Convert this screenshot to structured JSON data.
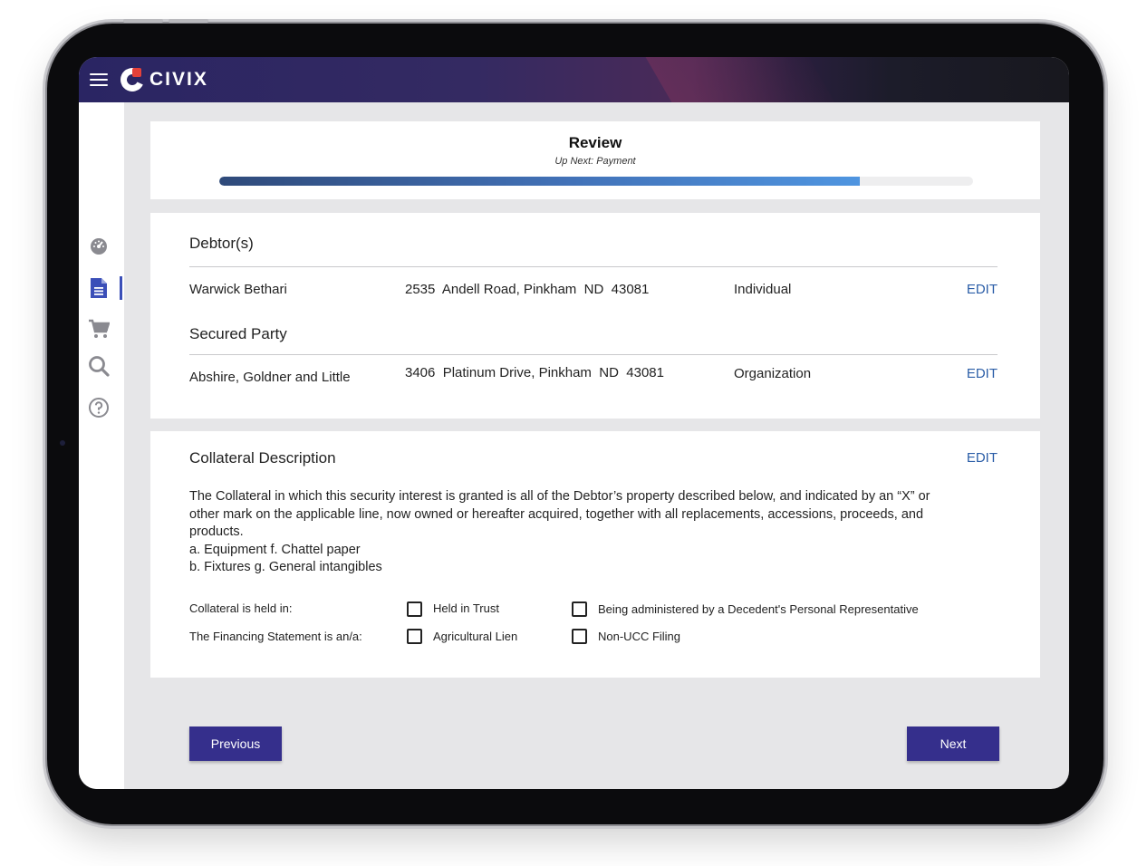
{
  "header": {
    "brand": "CIVIX"
  },
  "sidebar": {
    "items": [
      {
        "icon": "dashboard-icon"
      },
      {
        "icon": "document-icon",
        "active": true
      },
      {
        "icon": "cart-icon"
      },
      {
        "icon": "search-icon"
      },
      {
        "icon": "help-icon"
      }
    ]
  },
  "progress": {
    "title": "Review",
    "subtitle": "Up Next: Payment",
    "fraction": 0.85
  },
  "debtors": {
    "title": "Debtor(s)",
    "rows": [
      {
        "name": "Warwick Bethari",
        "address": "2535  Andell Road, Pinkham  ND  43081",
        "type": "Individual",
        "action": "EDIT"
      }
    ]
  },
  "secured_party": {
    "title": "Secured Party",
    "rows": [
      {
        "name": "Abshire, Goldner and Little",
        "address": "3406  Platinum Drive, Pinkham  ND  43081",
        "type": "Organization",
        "action": "EDIT"
      }
    ]
  },
  "collateral": {
    "title": "Collateral Description",
    "action": "EDIT",
    "description_lines": [
      "The Collateral in which this security interest is granted is all of the Debtor’s property described below, and indicated by an “X” or",
      "other mark on the applicable line, now owned or hereafter acquired, together with all replacements, accessions, proceeds, and",
      "products.",
      "a. Equipment f. Chattel paper",
      "b. Fixtures g. General intangibles"
    ],
    "held_in": {
      "label": "Collateral is held in:",
      "options": [
        {
          "label": "Held in Trust",
          "checked": false
        },
        {
          "label": "Being administered by a Decedent's Personal Representative",
          "checked": false
        }
      ]
    },
    "statement_is": {
      "label": "The Financing Statement is an/a:",
      "options": [
        {
          "label": "Agricultural Lien",
          "checked": false
        },
        {
          "label": "Non-UCC Filing",
          "checked": false
        }
      ]
    }
  },
  "nav": {
    "previous_label": "Previous",
    "next_label": "Next"
  },
  "colors": {
    "accent": "#352f8c",
    "link": "#2d5fa8",
    "header_start": "#2a2563",
    "header_end": "#18181e"
  }
}
